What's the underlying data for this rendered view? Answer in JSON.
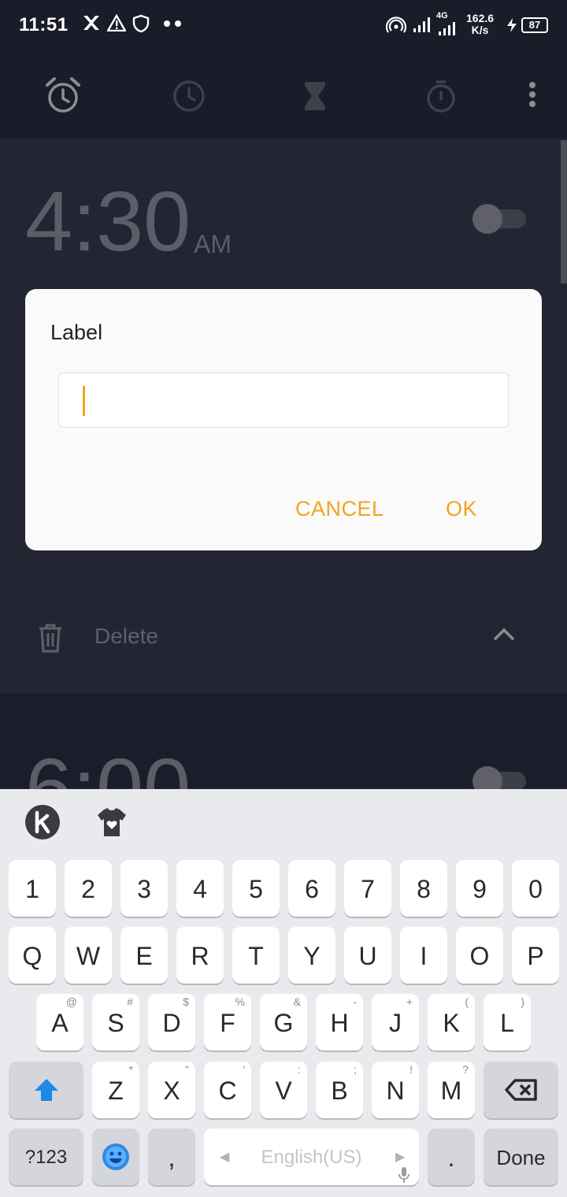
{
  "status_bar": {
    "time": "11:51",
    "speed_value": "162.6",
    "speed_unit": "K/s",
    "network_type": "4G",
    "battery": "87"
  },
  "tabs": [
    {
      "name": "alarm",
      "icon": "alarm-clock-icon"
    },
    {
      "name": "world-clock",
      "icon": "clock-icon"
    },
    {
      "name": "timer",
      "icon": "hourglass-icon"
    },
    {
      "name": "stopwatch",
      "icon": "stopwatch-icon"
    }
  ],
  "alarms": [
    {
      "time": "4:30",
      "ampm": "AM",
      "enabled": false
    },
    {
      "time": "6:00",
      "ampm": "",
      "enabled": false
    }
  ],
  "alarm_actions": {
    "delete_label": "Delete"
  },
  "dialog": {
    "title": "Label",
    "input_value": "",
    "cancel_label": "CANCEL",
    "ok_label": "OK"
  },
  "keyboard": {
    "number_row": [
      "1",
      "2",
      "3",
      "4",
      "5",
      "6",
      "7",
      "8",
      "9",
      "0"
    ],
    "row1": [
      "Q",
      "W",
      "E",
      "R",
      "T",
      "Y",
      "U",
      "I",
      "O",
      "P"
    ],
    "row2": [
      {
        "k": "A",
        "h": "@"
      },
      {
        "k": "S",
        "h": "#"
      },
      {
        "k": "D",
        "h": "$"
      },
      {
        "k": "F",
        "h": "%"
      },
      {
        "k": "G",
        "h": "&"
      },
      {
        "k": "H",
        "h": "-"
      },
      {
        "k": "J",
        "h": "+"
      },
      {
        "k": "K",
        "h": "("
      },
      {
        "k": "L",
        "h": ")"
      }
    ],
    "row3": [
      {
        "k": "Z",
        "h": "*"
      },
      {
        "k": "X",
        "h": "\""
      },
      {
        "k": "C",
        "h": "'"
      },
      {
        "k": "V",
        "h": ":"
      },
      {
        "k": "B",
        "h": ";"
      },
      {
        "k": "N",
        "h": "!"
      },
      {
        "k": "M",
        "h": "?"
      }
    ],
    "symbols_label": "?123",
    "comma_label": ",",
    "space_label": "English(US)",
    "period_label": ".",
    "done_label": "Done"
  },
  "colors": {
    "accent": "#f0a51c",
    "background": "#1b1d2a",
    "card": "#232533"
  }
}
